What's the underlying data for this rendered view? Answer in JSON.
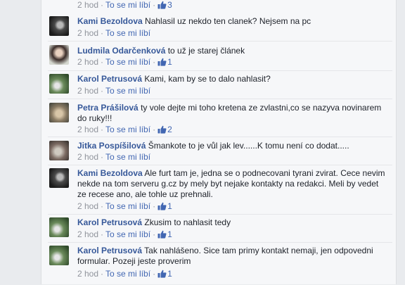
{
  "first_meta": {
    "time": "2 hod",
    "action": "To se mi líbí",
    "likes": "3"
  },
  "comments": [
    {
      "name": "Kami Bezoldova",
      "text": "Nahlasil uz nekdo ten clanek? Nejsem na pc",
      "time": "2 hod",
      "action": "To se mi líbí",
      "likes": "",
      "avatar": "dark-helmet"
    },
    {
      "name": "Ludmila Odarčenková",
      "text": "to už je starej článek",
      "time": "2 hod",
      "action": "To se mi líbí",
      "likes": "1",
      "avatar": "woman-portrait"
    },
    {
      "name": "Karol Petrusová",
      "text": "Kami, kam by se to dalo nahlasit?",
      "time": "2 hod",
      "action": "To se mi líbí",
      "likes": "",
      "avatar": "green-photo"
    },
    {
      "name": "Petra Prášilová",
      "text": "ty vole dejte mi toho kretena ze zvlastni,co se nazyva novinarem do ruky!!!",
      "time": "2 hod",
      "action": "To se mi líbí",
      "likes": "2",
      "avatar": "pets-photo"
    },
    {
      "name": "Jitka Pospíšilová",
      "text": "Šmankote to je vůl jak lev......K tomu není co dodat.....",
      "time": "2 hod",
      "action": "To se mi líbí",
      "likes": "",
      "avatar": "cat-photo"
    },
    {
      "name": "Kami Bezoldova",
      "text": "Ale furt tam je, jedna se o podnecovani tyrani zvirat. Cece nevim nekde na tom serveru g.cz by mely byt nejake kontakty na redakci. Meli by vedet ze recese ano, ale tohle uz prehnali.",
      "time": "2 hod",
      "action": "To se mi líbí",
      "likes": "1",
      "avatar": "dark-helmet"
    },
    {
      "name": "Karol Petrusová",
      "text": "Zkusim to nahlasit tedy",
      "time": "2 hod",
      "action": "To se mi líbí",
      "likes": "1",
      "avatar": "green-photo"
    },
    {
      "name": "Karol Petrusová",
      "text": "Tak nahlášeno. Sice tam primy kontakt nemaji, jen odpovedni formular. Pozeji jeste proverim",
      "time": "2 hod",
      "action": "To se mi líbí",
      "likes": "1",
      "avatar": "green-photo"
    }
  ],
  "colors": {
    "name": "#365899",
    "link": "#4267b2",
    "meta": "#90949c",
    "panel": "#f6f7f9"
  },
  "icons": {
    "like": "thumbs-up-icon",
    "separator": "·"
  }
}
